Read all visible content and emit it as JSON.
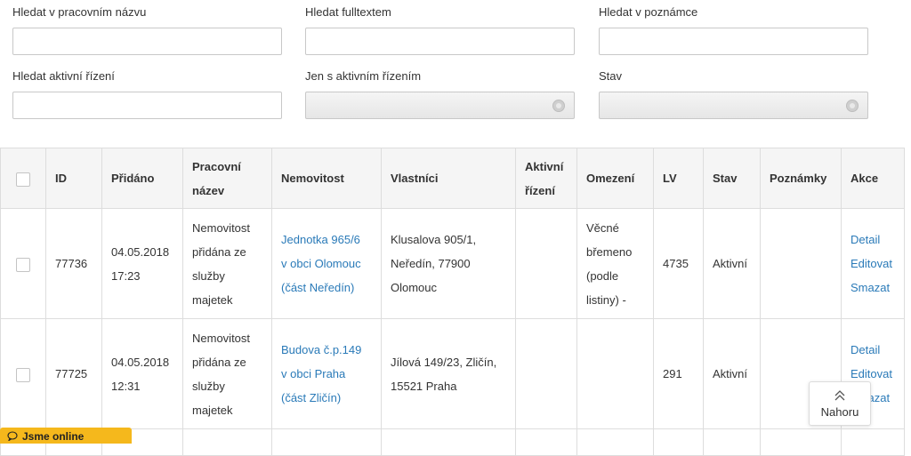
{
  "filters": {
    "pracovni_nazev": {
      "label": "Hledat v pracovním názvu",
      "value": ""
    },
    "fulltext": {
      "label": "Hledat fulltextem",
      "value": ""
    },
    "poznamka": {
      "label": "Hledat v poznámce",
      "value": ""
    },
    "aktivni_rizeni": {
      "label": "Hledat aktivní řízení",
      "value": ""
    },
    "jen_aktivni": {
      "label": "Jen s aktivním řízením",
      "selected": ""
    },
    "stav": {
      "label": "Stav",
      "selected": ""
    }
  },
  "table": {
    "headers": {
      "id": "ID",
      "pridano": "Přidáno",
      "pracovni_nazev_1": "Pracovní",
      "pracovni_nazev_2": "název",
      "nemovitost": "Nemovitost",
      "vlastnici": "Vlastníci",
      "aktivni_1": "Aktivní",
      "aktivni_2": "řízení",
      "omezeni": "Omezení",
      "lv": "LV",
      "stav": "Stav",
      "poznamky": "Poznámky",
      "akce": "Akce"
    },
    "rows": [
      {
        "id": "77736",
        "date": "04.05.2018",
        "time": "17:23",
        "name": [
          "Nemovitost",
          "přidána ze",
          "služby",
          "majetek"
        ],
        "property": [
          "Jednotka 965/6",
          "v obci Olomouc",
          "(část Neředín)"
        ],
        "owners": [
          "Klusalova 905/1,",
          "Neředín, 77900",
          "Olomouc"
        ],
        "restriction": [
          "Věcné",
          "břemeno",
          "(podle",
          "listiny) -"
        ],
        "lv": "4735",
        "status": "Aktivní",
        "actions": [
          "Detail",
          "Editovat",
          "Smazat"
        ]
      },
      {
        "id": "77725",
        "date": "04.05.2018",
        "time": "12:31",
        "name": [
          "Nemovitost",
          "přidána ze",
          "služby",
          "majetek"
        ],
        "property": [
          "Budova č.p.149",
          "v obci Praha",
          "(část Zličín)"
        ],
        "owners": [
          "Jílová 149/23, Zličín,",
          "15521 Praha"
        ],
        "restriction": [],
        "lv": "291",
        "status": "Aktivní",
        "actions": [
          "Detail",
          "Editovat",
          "Smazat"
        ]
      }
    ]
  },
  "back_to_top": {
    "label": "Nahoru"
  },
  "chat": {
    "label": "Jsme online"
  }
}
